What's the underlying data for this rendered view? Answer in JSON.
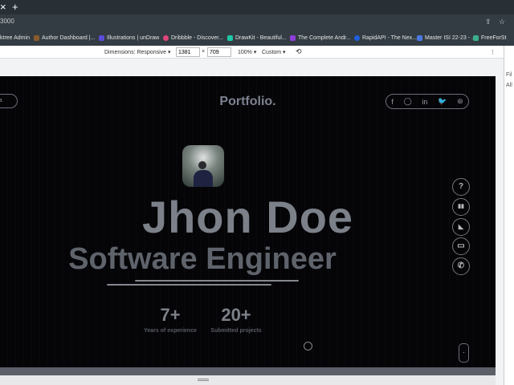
{
  "browser": {
    "new_tab": "+",
    "close": "×",
    "url": "3000",
    "bookmarks": [
      {
        "label": "ktree Admin",
        "color": "#333c42"
      },
      {
        "label": "Author Dashboard |...",
        "color": "#8a5a2b"
      },
      {
        "label": "Illustrations | unDraw",
        "color": "#5b4bd8"
      },
      {
        "label": "Dribbble - Discover...",
        "color": "#e0457b"
      },
      {
        "label": "DrawKit - Beautiful...",
        "color": "#1fc8a8"
      },
      {
        "label": "The Complete Andr...",
        "color": "#8d3ed8"
      },
      {
        "label": "RapidAPI - The Nex...",
        "color": "#1f5fe0"
      },
      {
        "label": "Master ISI 22-23 - ...",
        "color": "#4a7ae0"
      },
      {
        "label": "FreeForSt",
        "color": "#3bb08d"
      }
    ]
  },
  "devtools": {
    "dimensions": "Dimensions: Responsive ▾",
    "width": "1381",
    "x": "×",
    "height": "709",
    "zoom": "100% ▾",
    "throttle": "Custom ▾",
    "side_labels": [
      "Fil",
      "All"
    ]
  },
  "page": {
    "left_button": "ma",
    "logo": "Portfolio.",
    "social": [
      "f",
      "◯",
      "in",
      "🐦",
      "⊛"
    ],
    "name": "Jhon Doe",
    "role": "Software Engineer",
    "stats": [
      {
        "value": "7+",
        "label": "Years of experience"
      },
      {
        "value": "20+",
        "label": "Submitted projects"
      }
    ],
    "side_buttons": [
      "?",
      "▮▮",
      "◣",
      "▭",
      "✆"
    ],
    "scroll_button": "·"
  }
}
